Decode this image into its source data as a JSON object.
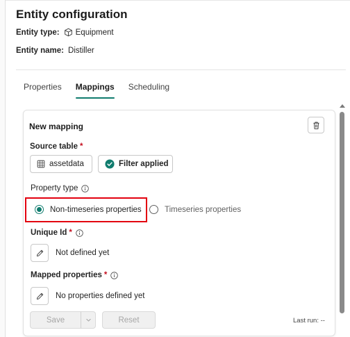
{
  "header": {
    "title": "Entity configuration",
    "entity_type_label": "Entity type:",
    "entity_type_value": "Equipment",
    "entity_name_label": "Entity name:",
    "entity_name_value": "Distiller"
  },
  "tabs": [
    {
      "label": "Properties",
      "active": false
    },
    {
      "label": "Mappings",
      "active": true
    },
    {
      "label": "Scheduling",
      "active": false
    }
  ],
  "mapping": {
    "section_title": "New mapping",
    "source_table_label": "Source table",
    "required_mark": "*",
    "source_table_value": "assetdata",
    "filter_label": "Filter applied",
    "property_type_label": "Property type",
    "radio_options": [
      {
        "label": "Non-timeseries properties",
        "checked": true
      },
      {
        "label": "Timeseries properties",
        "checked": false
      }
    ],
    "unique_id_label": "Unique Id",
    "unique_id_value": "Not defined yet",
    "mapped_properties_label": "Mapped properties",
    "mapped_properties_value": "No properties defined yet"
  },
  "footer": {
    "save_label": "Save",
    "reset_label": "Reset",
    "last_run": "Last run: --"
  },
  "colors": {
    "accent": "#107c6e",
    "required": "#c50f1f",
    "highlight": "#e3000f"
  },
  "icons": [
    "cube-icon",
    "table-grid-icon",
    "check-circle-icon",
    "info-icon",
    "pencil-icon",
    "trash-icon",
    "chevron-down-icon"
  ]
}
